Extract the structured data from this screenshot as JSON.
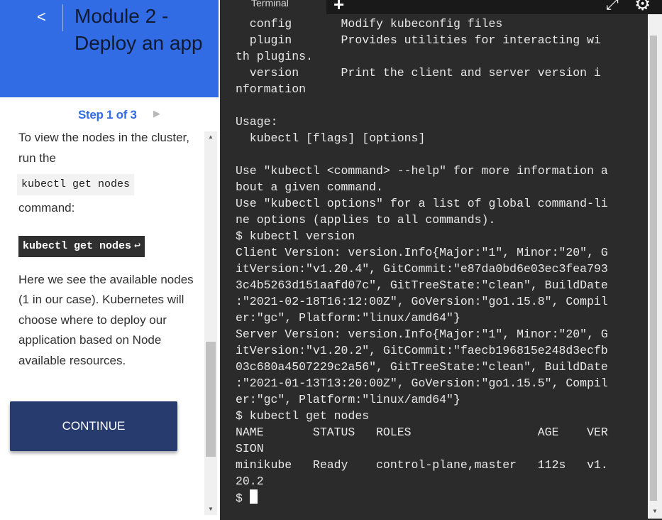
{
  "tutorial": {
    "back_label": "<",
    "title": "Module 2 - Deploy an app",
    "step_label": "Step 1 of 3",
    "next_label": "▶",
    "para1_text": "To view the nodes in the cluster, run the",
    "inline_command": "kubectl get nodes",
    "para1_tail": "command:",
    "code_block": "kubectl get nodes",
    "enter_symbol": "↩",
    "para2_text": "Here we see the available nodes (1 in our case). Kubernetes will choose where to deploy our application based on Node available resources.",
    "continue_label": "CONTINUE"
  },
  "terminal": {
    "tab_label": "Terminal",
    "plus_symbol": "+",
    "fullscreen_symbol": "⤢",
    "gear_symbol": "⚙",
    "prompt": "$ ",
    "lines": [
      "  config       Modify kubeconfig files",
      "  plugin       Provides utilities for interacting wi",
      "th plugins.",
      "  version      Print the client and server version i",
      "nformation",
      "",
      "Usage:",
      "  kubectl [flags] [options]",
      "",
      "Use \"kubectl <command> --help\" for more information a",
      "bout a given command.",
      "Use \"kubectl options\" for a list of global command-li",
      "ne options (applies to all commands).",
      "$ kubectl version",
      "Client Version: version.Info{Major:\"1\", Minor:\"20\", G",
      "itVersion:\"v1.20.4\", GitCommit:\"e87da0bd6e03ec3fea793",
      "3c4b5263d151aafd07c\", GitTreeState:\"clean\", BuildDate",
      ":\"2021-02-18T16:12:00Z\", GoVersion:\"go1.15.8\", Compil",
      "er:\"gc\", Platform:\"linux/amd64\"}",
      "Server Version: version.Info{Major:\"1\", Minor:\"20\", G",
      "itVersion:\"v1.20.2\", GitCommit:\"faecb196815e248d3ecfb",
      "03c680a4507229c2a56\", GitTreeState:\"clean\", BuildDate",
      ":\"2021-01-13T13:20:00Z\", GoVersion:\"go1.15.5\", Compil",
      "er:\"gc\", Platform:\"linux/amd64\"}",
      "$ kubectl get nodes",
      "NAME       STATUS   ROLES                  AGE    VER",
      "SION",
      "minikube   Ready    control-plane,master   112s   v1.",
      "20.2"
    ]
  },
  "colors": {
    "header_bg": "#326ce5",
    "continue_bg": "#273b6e",
    "terminal_bg": "#2b2b2b"
  }
}
